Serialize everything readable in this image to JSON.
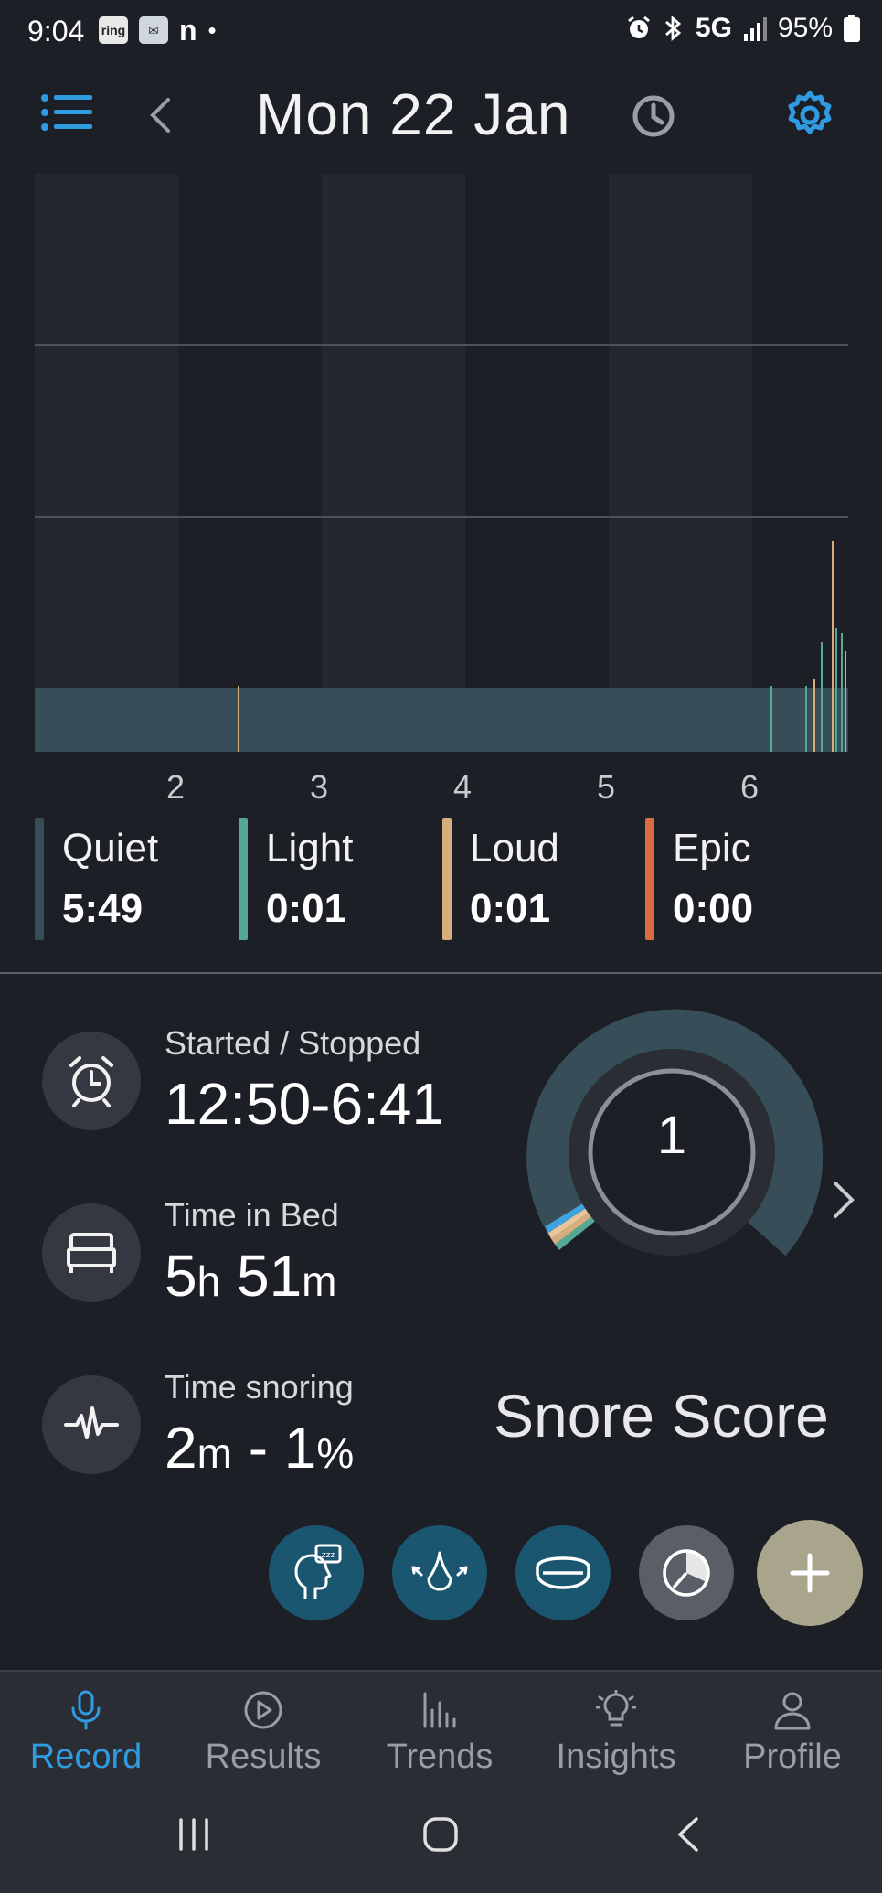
{
  "status_bar": {
    "time": "9:04",
    "app_badges": [
      "ring",
      "outlook",
      "n"
    ],
    "network": "5G",
    "battery": "95%"
  },
  "header": {
    "date": "Mon 22 Jan",
    "icons": [
      "menu-icon",
      "back-chevron-icon",
      "history-clock-icon",
      "settings-gear-icon"
    ]
  },
  "chart_data": {
    "type": "area",
    "x_ticks": [
      "2",
      "3",
      "4",
      "5",
      "6"
    ],
    "series": [
      {
        "name": "Quiet",
        "color": "#374e58",
        "values": [
          0.32
        ]
      },
      {
        "name": "Light",
        "color": "#55a894",
        "values": [
          0.01
        ]
      },
      {
        "name": "Loud",
        "color": "#d6ae7d",
        "values": [
          0.01
        ]
      },
      {
        "name": "Epic",
        "color": "#d96c43",
        "values": [
          0.0
        ]
      }
    ],
    "grid": true,
    "legend": "bottom"
  },
  "legend": [
    {
      "label": "Quiet",
      "value": "5:49",
      "color": "#374e58"
    },
    {
      "label": "Light",
      "value": "0:01",
      "color": "#55a894"
    },
    {
      "label": "Loud",
      "value": "0:01",
      "color": "#d6ae7d"
    },
    {
      "label": "Epic",
      "value": "0:00",
      "color": "#d96c43"
    }
  ],
  "stats": {
    "started_stopped": {
      "label": "Started / Stopped",
      "value": "12:50-6:41"
    },
    "time_in_bed": {
      "label": "Time in Bed",
      "h": "5",
      "h_unit": "h",
      "m": "51",
      "m_unit": "m"
    },
    "time_snoring": {
      "label": "Time snoring",
      "m": "2",
      "m_unit": "m",
      "sep": " - ",
      "pct": "1",
      "pct_unit": "%"
    }
  },
  "score": {
    "value": "1",
    "title": "Snore Score"
  },
  "nav": {
    "items": [
      {
        "label": "Record",
        "active": true
      },
      {
        "label": "Results"
      },
      {
        "label": "Trends"
      },
      {
        "label": "Insights"
      },
      {
        "label": "Profile"
      }
    ]
  },
  "colors": {
    "accent": "#2f9be0",
    "background": "#1d1f26",
    "gauge_track": "#374e58",
    "action_teal": "#1b5670",
    "action_add": "#a9a58c"
  }
}
